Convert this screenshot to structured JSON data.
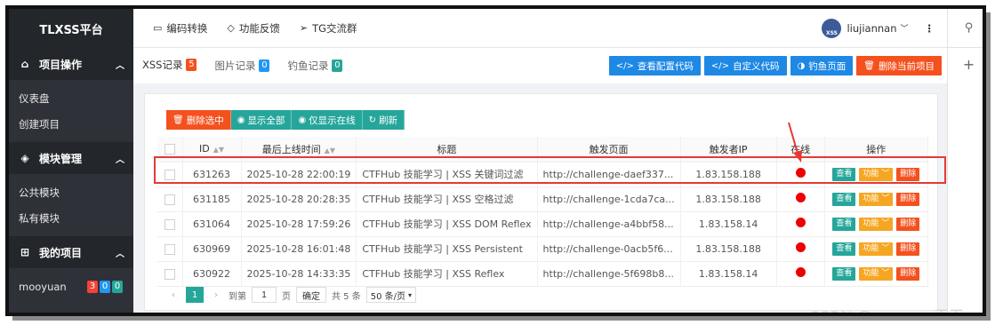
{
  "sidebar": {
    "brand": "TLXSS平台",
    "groups": [
      {
        "label": "项目操作",
        "items": [
          "仪表盘",
          "创建项目"
        ]
      },
      {
        "label": "模块管理",
        "items": [
          "公共模块",
          "私有模块"
        ]
      },
      {
        "label": "我的项目",
        "items": [
          "mooyuan"
        ]
      }
    ],
    "project_badges": [
      "3",
      "0",
      "0"
    ]
  },
  "topbar": {
    "links": [
      "编码转换",
      "功能反馈",
      "TG交流群"
    ],
    "username": "liujiannan",
    "avatar_text": "XSS"
  },
  "tabs": [
    {
      "label": "XSS记录",
      "count": "5",
      "color": "#f4511e"
    },
    {
      "label": "图片记录",
      "count": "0",
      "color": "#2196f3"
    },
    {
      "label": "钓鱼记录",
      "count": "0",
      "color": "#26a69a"
    }
  ],
  "tab_actions": [
    "查看配置代码",
    "自定义代码",
    "钓鱼页面",
    "删除当前项目"
  ],
  "toolbar": [
    "删除选中",
    "显示全部",
    "仅显示在线",
    "刷新"
  ],
  "table": {
    "headers": [
      "ID",
      "最后上线时间",
      "标题",
      "触发页面",
      "触发者IP",
      "在线",
      "操作"
    ],
    "rows": [
      [
        "631263",
        "2025-10-28 22:00:19",
        "CTFHub 技能学习 | XSS 关键词过滤",
        "http://challenge-daef337...",
        "1.83.158.188"
      ],
      [
        "631185",
        "2025-10-28 20:28:35",
        "CTFHub 技能学习 | XSS 空格过滤",
        "http://challenge-1cda7ca...",
        "1.83.158.188"
      ],
      [
        "631064",
        "2025-10-28 17:59:26",
        "CTFHub 技能学习 | XSS DOM Reflex",
        "http://challenge-a4bbf58...",
        "1.83.158.14"
      ],
      [
        "630969",
        "2025-10-28 16:01:48",
        "CTFHub 技能学习 | XSS Persistent",
        "http://challenge-0acb5f6...",
        "1.83.158.188"
      ],
      [
        "630922",
        "2025-10-28 14:33:35",
        "CTFHub 技能学习 | XSS Reflex",
        "http://challenge-5f698b8...",
        "1.83.158.14"
      ]
    ],
    "row_actions": [
      "查看",
      "功能",
      "删除"
    ]
  },
  "pager": {
    "current": "1",
    "goto_label": "到第",
    "page_input": "1",
    "page_unit": "页",
    "confirm": "确定",
    "total": "共 5 条",
    "page_size": "50 条/页"
  },
  "watermark": "CSDN @mooyuan天天",
  "colors": {
    "accent_teal": "#26a69a",
    "accent_blue": "#1e88e5",
    "danger": "#f4511e",
    "online_dot": "#e00000"
  }
}
